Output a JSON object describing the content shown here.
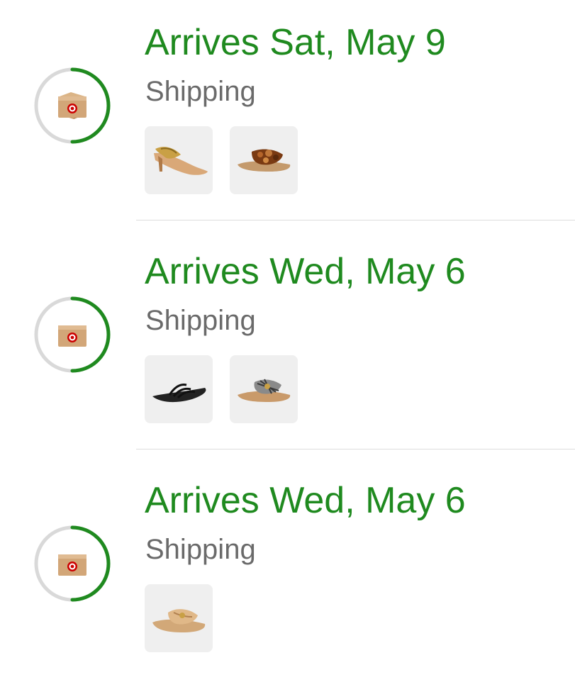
{
  "orders": [
    {
      "title": "Arrives Sat, May 9",
      "status": "Shipping",
      "progress": 0.5,
      "items": [
        {
          "icon": "gold-flip-flop-heel-icon"
        },
        {
          "icon": "tortoise-slide-sandal-icon"
        }
      ]
    },
    {
      "title": "Arrives Wed, May 6",
      "status": "Shipping",
      "progress": 0.5,
      "items": [
        {
          "icon": "black-strappy-sandal-icon"
        },
        {
          "icon": "woven-slide-sandal-icon"
        }
      ]
    },
    {
      "title": "Arrives Wed, May 6",
      "status": "Shipping",
      "progress": 0.5,
      "items": [
        {
          "icon": "tan-knot-slide-sandal-icon"
        }
      ]
    }
  ],
  "colors": {
    "accent_green": "#1f8a1f",
    "ring_track": "#d9d9d9",
    "status_gray": "#6a6a6a",
    "thumb_bg": "#efefef",
    "box_brown": "#c89a6a",
    "target_red": "#cc0000"
  }
}
